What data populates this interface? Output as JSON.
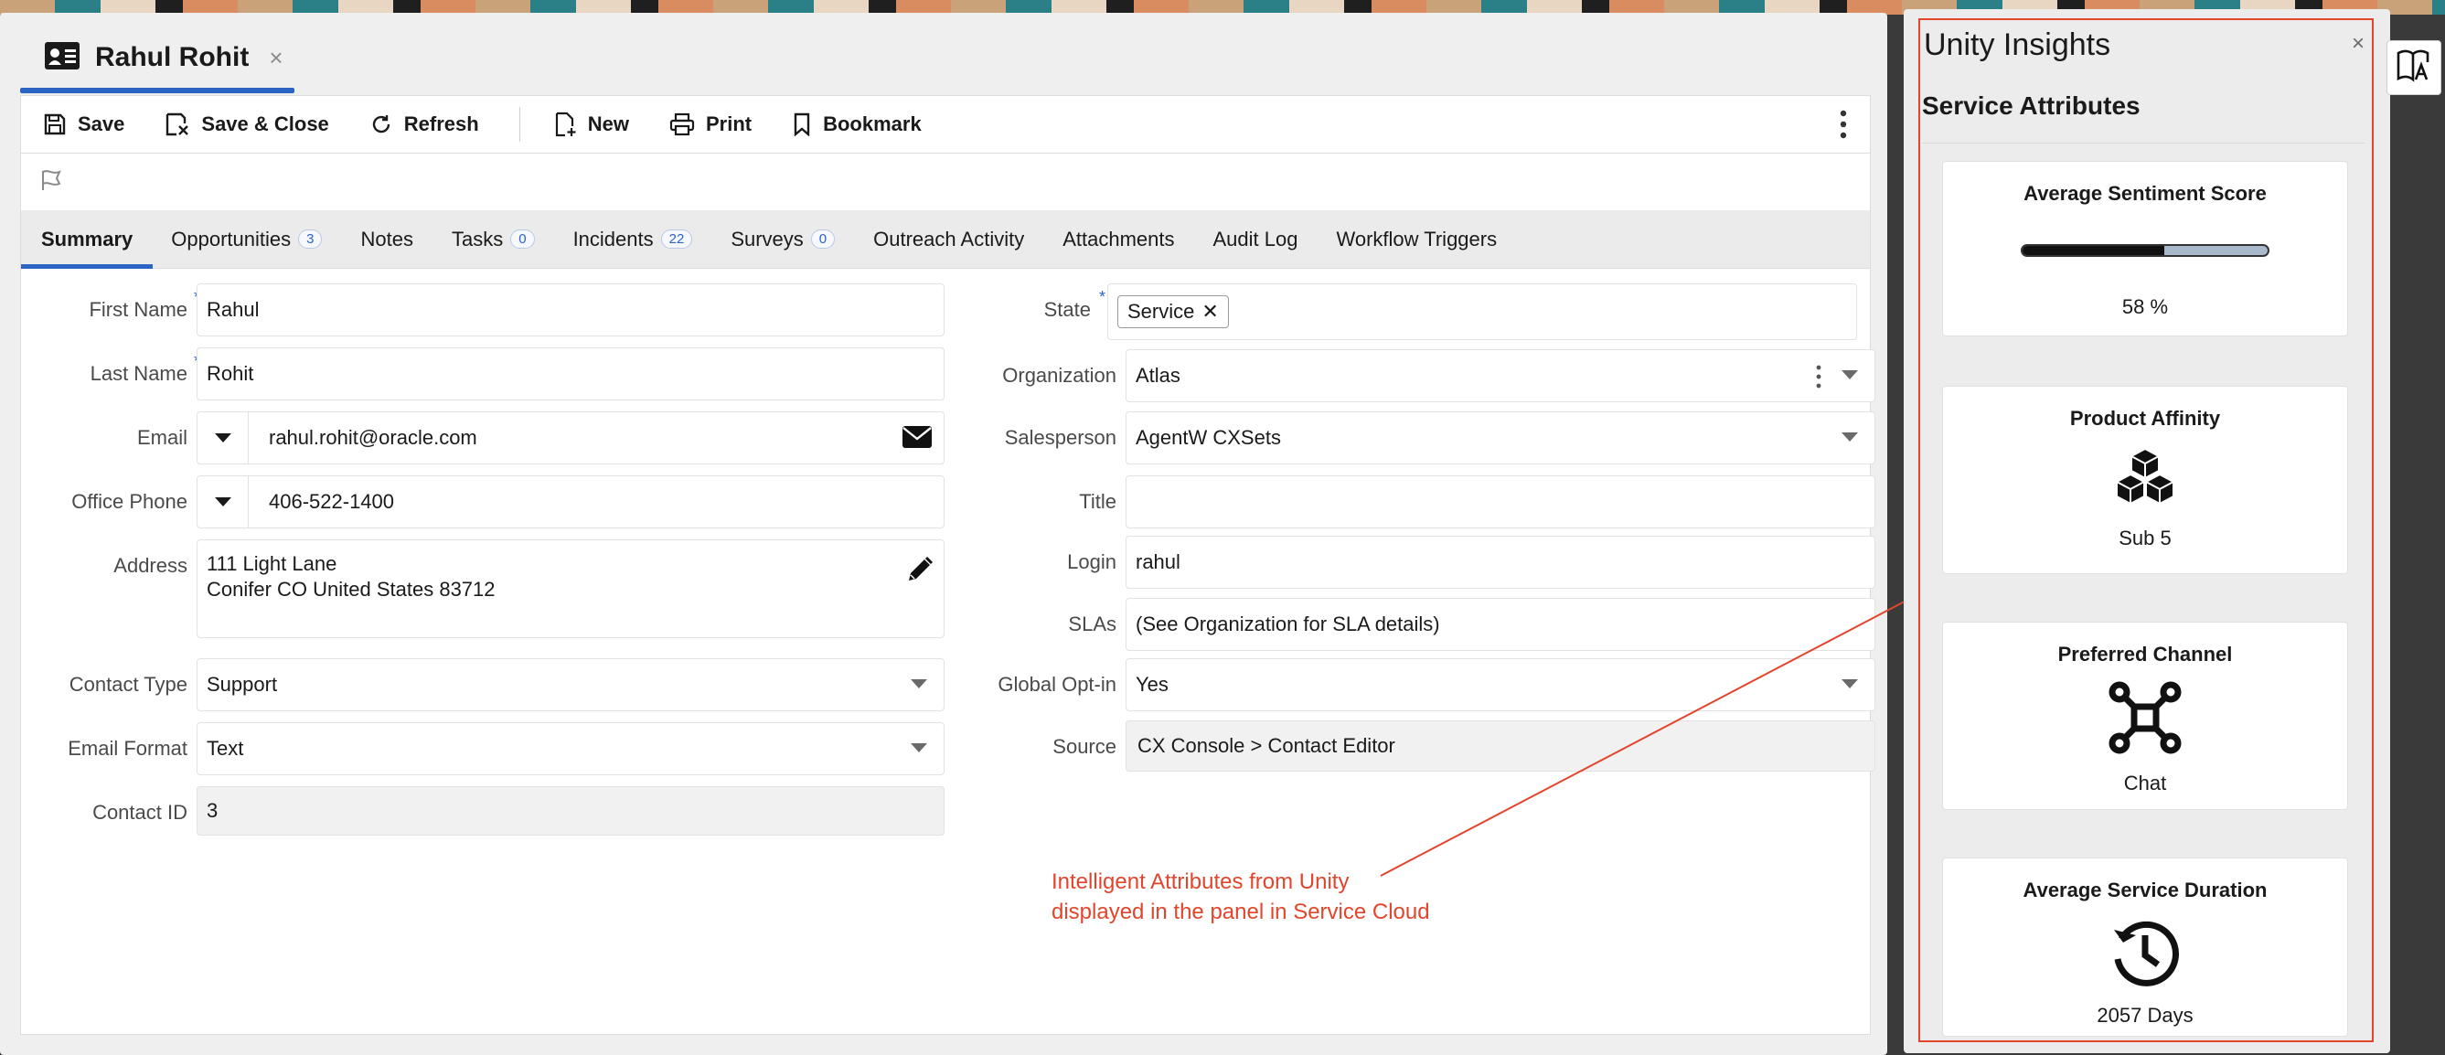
{
  "record": {
    "title": "Rahul Rohit",
    "close": "×"
  },
  "toolbar": {
    "save": "Save",
    "save_close": "Save & Close",
    "refresh": "Refresh",
    "new": "New",
    "print": "Print",
    "bookmark": "Bookmark"
  },
  "tabs": [
    {
      "label": "Summary",
      "badge": ""
    },
    {
      "label": "Opportunities",
      "badge": "3"
    },
    {
      "label": "Notes",
      "badge": ""
    },
    {
      "label": "Tasks",
      "badge": "0"
    },
    {
      "label": "Incidents",
      "badge": "22"
    },
    {
      "label": "Surveys",
      "badge": "0"
    },
    {
      "label": "Outreach Activity",
      "badge": ""
    },
    {
      "label": "Attachments",
      "badge": ""
    },
    {
      "label": "Audit Log",
      "badge": ""
    },
    {
      "label": "Workflow Triggers",
      "badge": ""
    }
  ],
  "form": {
    "first_name": {
      "label": "First Name",
      "value": "Rahul"
    },
    "last_name": {
      "label": "Last Name",
      "value": "Rohit"
    },
    "email": {
      "label": "Email",
      "value": "rahul.rohit@oracle.com"
    },
    "office_phone": {
      "label": "Office Phone",
      "value": "406-522-1400"
    },
    "address": {
      "label": "Address",
      "line1": "111 Light Lane",
      "line2": "Conifer CO United States 83712"
    },
    "contact_type": {
      "label": "Contact Type",
      "value": "Support"
    },
    "email_format": {
      "label": "Email Format",
      "value": "Text"
    },
    "contact_id": {
      "label": "Contact ID",
      "value": "3"
    },
    "state": {
      "label": "State",
      "value": "Service"
    },
    "organization": {
      "label": "Organization",
      "value": "Atlas"
    },
    "salesperson": {
      "label": "Salesperson",
      "value": "AgentW CXSets"
    },
    "title": {
      "label": "Title",
      "value": ""
    },
    "login": {
      "label": "Login",
      "value": "rahul"
    },
    "slas": {
      "label": "SLAs",
      "value": "(See Organization for SLA details)"
    },
    "global_optin": {
      "label": "Global Opt-in",
      "value": "Yes"
    },
    "source": {
      "label": "Source",
      "value": "CX Console > Contact Editor"
    },
    "required_mark": "*"
  },
  "annotation": {
    "line1": "Intelligent Attributes from Unity",
    "line2": "displayed in the panel in Service Cloud",
    "color": "#e2452b"
  },
  "insights": {
    "title": "Unity Insights",
    "close": "×",
    "section": "Service Attributes",
    "cards": [
      {
        "title": "Average Sentiment Score",
        "value": "58 %",
        "progress": 0.58,
        "icon": "progress-bar"
      },
      {
        "title": "Product Affinity",
        "value": "Sub 5",
        "icon": "cubes-icon"
      },
      {
        "title": "Preferred Channel",
        "value": "Chat",
        "icon": "network-icon"
      },
      {
        "title": "Average Service Duration",
        "value": "2057 Days",
        "icon": "history-icon"
      }
    ]
  },
  "colors": {
    "accent": "#2c64c3",
    "annotation": "#e2452b"
  }
}
